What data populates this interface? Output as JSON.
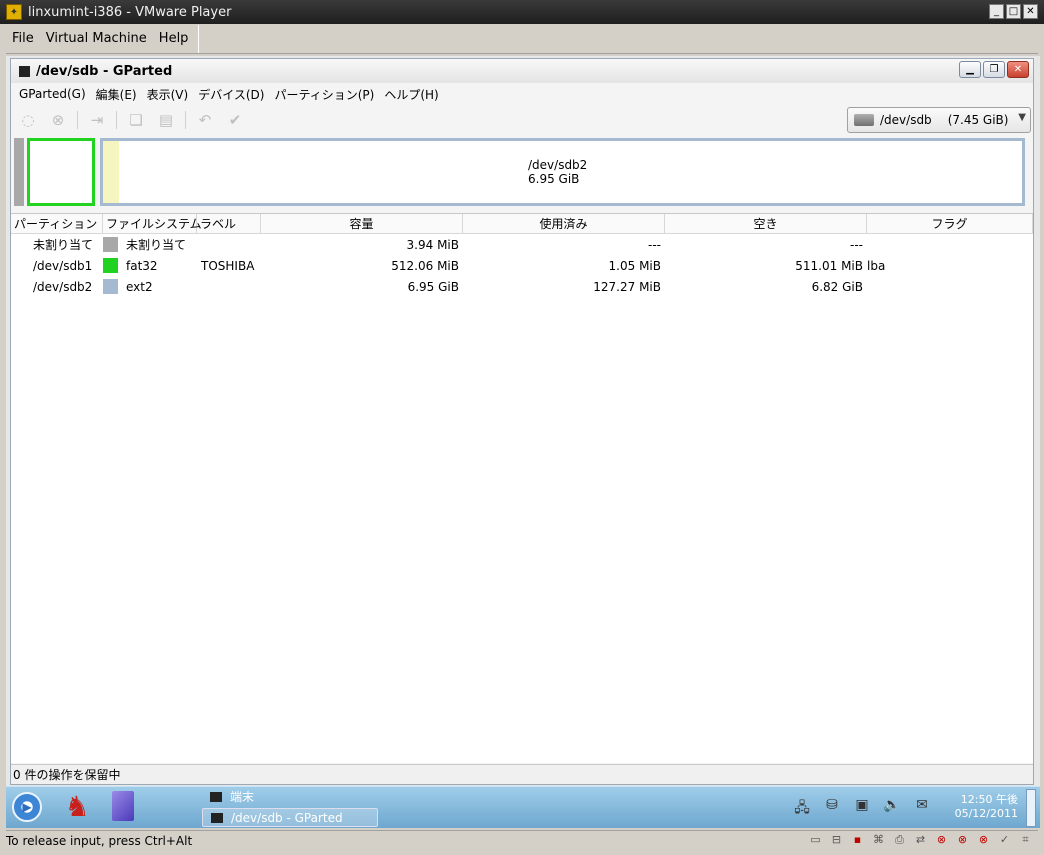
{
  "vm": {
    "title": "linxumint-i386 - VMware Player",
    "menu": [
      "File",
      "Virtual Machine",
      "Help"
    ],
    "window_buttons": [
      "_",
      "□",
      "✕"
    ],
    "status_message": "To release input, press Ctrl+Alt",
    "device_icons": [
      "hdd-icon",
      "floppy-icon",
      "disk-icon",
      "usb-icon",
      "printer-icon",
      "network-icon",
      "sound-icon",
      "error-icon",
      "error-icon",
      "check-icon",
      "network-icon"
    ]
  },
  "gparted": {
    "title": "/dev/sdb - GParted",
    "menu": [
      "GParted(G)",
      "編集(E)",
      "表示(V)",
      "デバイス(D)",
      "パーティション(P)",
      "ヘルプ(H)"
    ],
    "device": {
      "name": "/dev/sdb",
      "size": "(7.45 GiB)"
    },
    "disk_map": {
      "p2_name": "/dev/sdb2",
      "p2_size": "6.95 GiB"
    },
    "columns": [
      "パーティション",
      "ファイルシステム",
      "ラベル",
      "容量",
      "使用済み",
      "空き",
      "フラグ"
    ],
    "rows": [
      {
        "partition": "未割り当て",
        "filesystem": "未割り当て",
        "color": "#a8a8a8",
        "label": "",
        "size": "3.94 MiB",
        "used": "---",
        "unused": "---",
        "flags": ""
      },
      {
        "partition": "/dev/sdb1",
        "filesystem": "fat32",
        "color": "#21d221",
        "label": "TOSHIBA",
        "size": "512.06 MiB",
        "used": "1.05 MiB",
        "unused": "511.01 MiB",
        "flags": "lba"
      },
      {
        "partition": "/dev/sdb2",
        "filesystem": "ext2",
        "color": "#a5b9d0",
        "label": "",
        "size": "6.95 GiB",
        "used": "127.27 MiB",
        "unused": "6.82 GiB",
        "flags": ""
      }
    ],
    "status": "0 件の操作を保留中"
  },
  "panel": {
    "tasks": [
      "端末",
      "/dev/sdb - GParted"
    ],
    "clock_time": "12:50 午後",
    "clock_date": "05/12/2011"
  }
}
